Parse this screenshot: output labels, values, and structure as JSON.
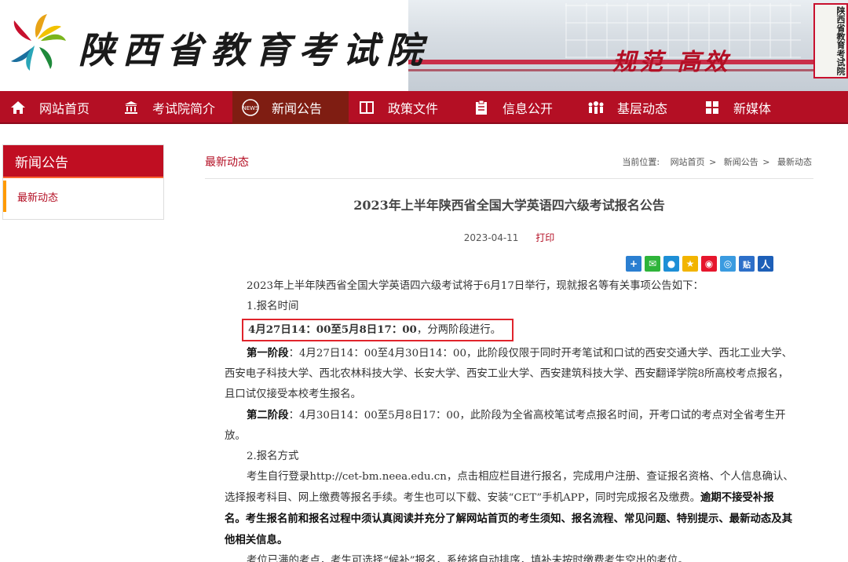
{
  "header": {
    "site_title": "陕西省教育考试院",
    "slogan": "规范 高效",
    "plaque": "陕西省教育考试院"
  },
  "nav": [
    {
      "label": "网站首页",
      "icon": "home-icon"
    },
    {
      "label": "考试院简介",
      "icon": "building-icon"
    },
    {
      "label": "新闻公告",
      "icon": "news-icon",
      "active": true
    },
    {
      "label": "政策文件",
      "icon": "book-icon"
    },
    {
      "label": "信息公开",
      "icon": "clipboard-icon"
    },
    {
      "label": "基层动态",
      "icon": "people-icon"
    },
    {
      "label": "新媒体",
      "icon": "grid-icon"
    }
  ],
  "sidebar": {
    "heading": "新闻公告",
    "items": [
      {
        "label": "最新动态"
      }
    ]
  },
  "main": {
    "section_title": "最新动态",
    "breadcrumb": {
      "prefix": "当前位置:",
      "items": [
        "网站首页",
        "新闻公告",
        "最新动态"
      ],
      "separator": ">"
    }
  },
  "article": {
    "title": "2023年上半年陕西省全国大学英语四六级考试报名公告",
    "date": "2023-04-11",
    "print_label": "打印",
    "share_icons": [
      "plus-share-icon",
      "wechat-icon",
      "qq-icon",
      "qzone-icon",
      "weibo-icon",
      "tencent-weibo-icon",
      "tieba-icon",
      "renren-icon"
    ],
    "p1": "2023年上半年陕西省全国大学英语四六级考试将于6月17日举行，现就报名等有关事项公告如下：",
    "h1": "1.报名时间",
    "highlight_bold": "4月27日14：00至5月8日17：00",
    "highlight_rest": "，分两阶段进行。",
    "stage1_label": "第一阶段",
    "stage1_text": "：4月27日14：00至4月30日14：00，此阶段仅限于同时开考笔试和口试的西安交通大学、西北工业大学、西安电子科技大学、西北农林科技大学、长安大学、西安工业大学、西安建筑科技大学、西安翻译学院8所高校考点报名，且口试仅接受本校考生报名。",
    "stage2_label": "第二阶段",
    "stage2_text": "：4月30日14：00至5月8日17：00，此阶段为全省高校笔试考点报名时间，开考口试的考点对全省考生开放。",
    "h2": "2.报名方式",
    "p2_normal": "考生自行登录http://cet-bm.neea.edu.cn，点击相应栏目进行报名，完成用户注册、查证报名资格、个人信息确认、选择报考科目、网上缴费等报名手续。考生也可以下载、安装“CET”手机APP，同时完成报名及缴费。",
    "p2_bold": "逾期不接受补报名。考生报名前和报名过程中须认真阅读并充分了解网站首页的考生须知、报名流程、常见问题、特别提示、最新动态及其他相关信息。",
    "p3": "考位已满的考点，考生可选择“候补”报名，系统将自动排序，填补未按时缴费考生空出的考位。"
  }
}
